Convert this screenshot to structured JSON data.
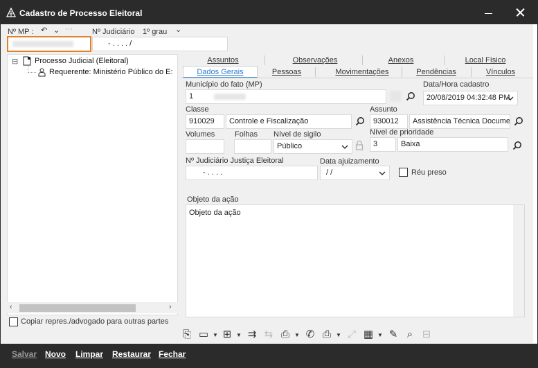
{
  "window": {
    "title": "Cadastro de Processo Eleitoral"
  },
  "header": {
    "mp_label": "Nº MP :",
    "mp_value": "",
    "judiciario_label": "Nº Judiciário",
    "grau_label": "1º grau",
    "judiciario_mask": "-  .  . . .  /"
  },
  "tree": {
    "items": [
      {
        "label": "Processo Judicial (Eleitoral)",
        "expand": "⊟"
      },
      {
        "label": "Requerente: Ministério Público do E:"
      }
    ]
  },
  "copy_checkbox": {
    "label": "Copiar repres./advogado para outras partes",
    "checked": false
  },
  "tabs": {
    "row1": [
      "Assuntos",
      "Observações",
      "Anexos",
      "Local Físico"
    ],
    "row2": [
      "Dados Gerais",
      "Pessoas",
      "Movimentações",
      "Pendências",
      "Vínculos"
    ],
    "active": "Dados Gerais"
  },
  "form": {
    "municipio_label": "Município do fato (MP)",
    "municipio_value": "1",
    "data_cadastro_label": "Data/Hora cadastro",
    "data_cadastro_value": "20/08/2019 04:32:48 PM",
    "classe_label": "Classe",
    "classe_code": "910029",
    "classe_desc": "Controle e Fiscalização",
    "assunto_label": "Assunto",
    "assunto_code": "930012",
    "assunto_desc": "Assistência Técnica Documen",
    "volumes_label": "Volumes",
    "volumes_value": "",
    "folhas_label": "Folhas",
    "folhas_value": "",
    "sigilo_label": "Nível de sigilo",
    "sigilo_value": "Público",
    "prioridade_label": "Nível de prioridade",
    "prioridade_code": "3",
    "prioridade_desc": "Baixa",
    "judiciario_eleitoral_label": "Nº Judiciário Justiça Eleitoral",
    "judiciario_eleitoral_value": "-  .   . . .",
    "data_ajuizamento_label": "Data ajuizamento",
    "data_ajuizamento_value": "/ /",
    "reu_preso_label": "Réu preso",
    "reu_preso_checked": false,
    "objeto_label": "Objeto da ação",
    "objeto_value": "Objeto da ação"
  },
  "footer": {
    "salvar": "Salvar",
    "novo": "Novo",
    "limpar": "Limpar",
    "restaurar": "Restaurar",
    "fechar": "Fechar"
  },
  "colors": {
    "titlebar": "#2b2b2b",
    "mp_focus": "#e0822b",
    "active_tab": "#2d7ad1"
  }
}
